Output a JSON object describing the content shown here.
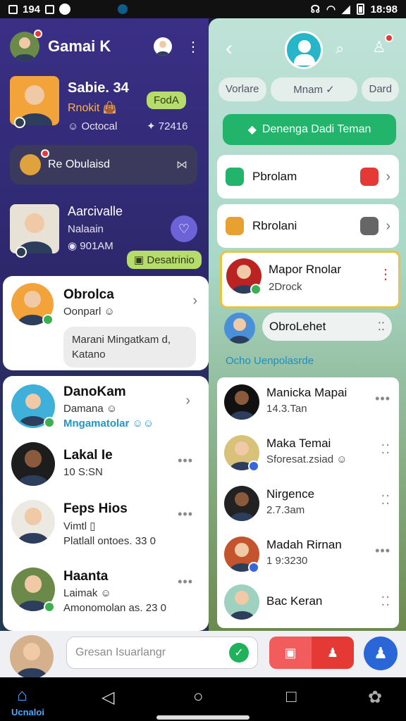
{
  "status": {
    "time_left": "194",
    "time_right": "18:98"
  },
  "left": {
    "app_title": "Gamai K",
    "profile": {
      "name": "Sabie. 34",
      "line1": "Rnokit",
      "line2": "Octocal",
      "stat": "72416",
      "chip": "FodA"
    },
    "notice": {
      "text": "Re Obulaisd"
    },
    "contact2": {
      "name": "Aarcivalle",
      "line1": "Nalaain",
      "line2": "901AM",
      "chip": "Desatrinio"
    },
    "chats": [
      {
        "name": "Obrolca",
        "sub": "Oonparl",
        "bubble": "Marani Mingatkam d, Katano"
      },
      {
        "name": "DanoKam",
        "sub": "Damana",
        "sub2": "Mngamatolar"
      },
      {
        "name": "Lakal Ie",
        "sub": "10 S:SN"
      },
      {
        "name": "Feps Hios",
        "sub": "Vimtl",
        "sub2": "Platlall ontoes. 33 0"
      },
      {
        "name": "Haanta",
        "sub": "Laimak",
        "sub2": "Amonomolan as. 23 0"
      }
    ]
  },
  "right": {
    "tabs": [
      "Vorlare",
      "Mnam",
      "Dard"
    ],
    "green_button": "Denenga Dadi Teman",
    "cards": [
      {
        "title": "Pbrolam"
      },
      {
        "title": "Rbrolani"
      }
    ],
    "highlight": {
      "name": "Mapor Rnolar",
      "sub": "2Drock"
    },
    "row2": {
      "name": "ObroLehet"
    },
    "section_title": "Ocho Uenpolasrde",
    "list": [
      {
        "name": "Manicka Mapai",
        "sub": "14.3.Tan"
      },
      {
        "name": "Maka Temai",
        "sub": "Sforesat.zsiad"
      },
      {
        "name": "Nirgence",
        "sub": "2.7.3am"
      },
      {
        "name": "Madah Rirnan",
        "sub": "1 9:3230"
      },
      {
        "name": "Bac Keran",
        "sub": ""
      }
    ]
  },
  "bottom": {
    "input_placeholder": "Gresan Isuarlangr",
    "home_label": "Ucnaloi"
  },
  "icons": {
    "menu": "more-vertical-icon",
    "back": "chevron-left-icon",
    "search": "search-icon",
    "add_user": "add-user-icon",
    "home": "home-icon"
  },
  "colors": {
    "left_bg": "#3a2f86",
    "right_bg": "#bfe2d7",
    "green": "#21b46a",
    "chip_green": "#b6dc6b",
    "red": "#e53935",
    "blue": "#2a66d8",
    "highlight_border": "#f0c040"
  }
}
